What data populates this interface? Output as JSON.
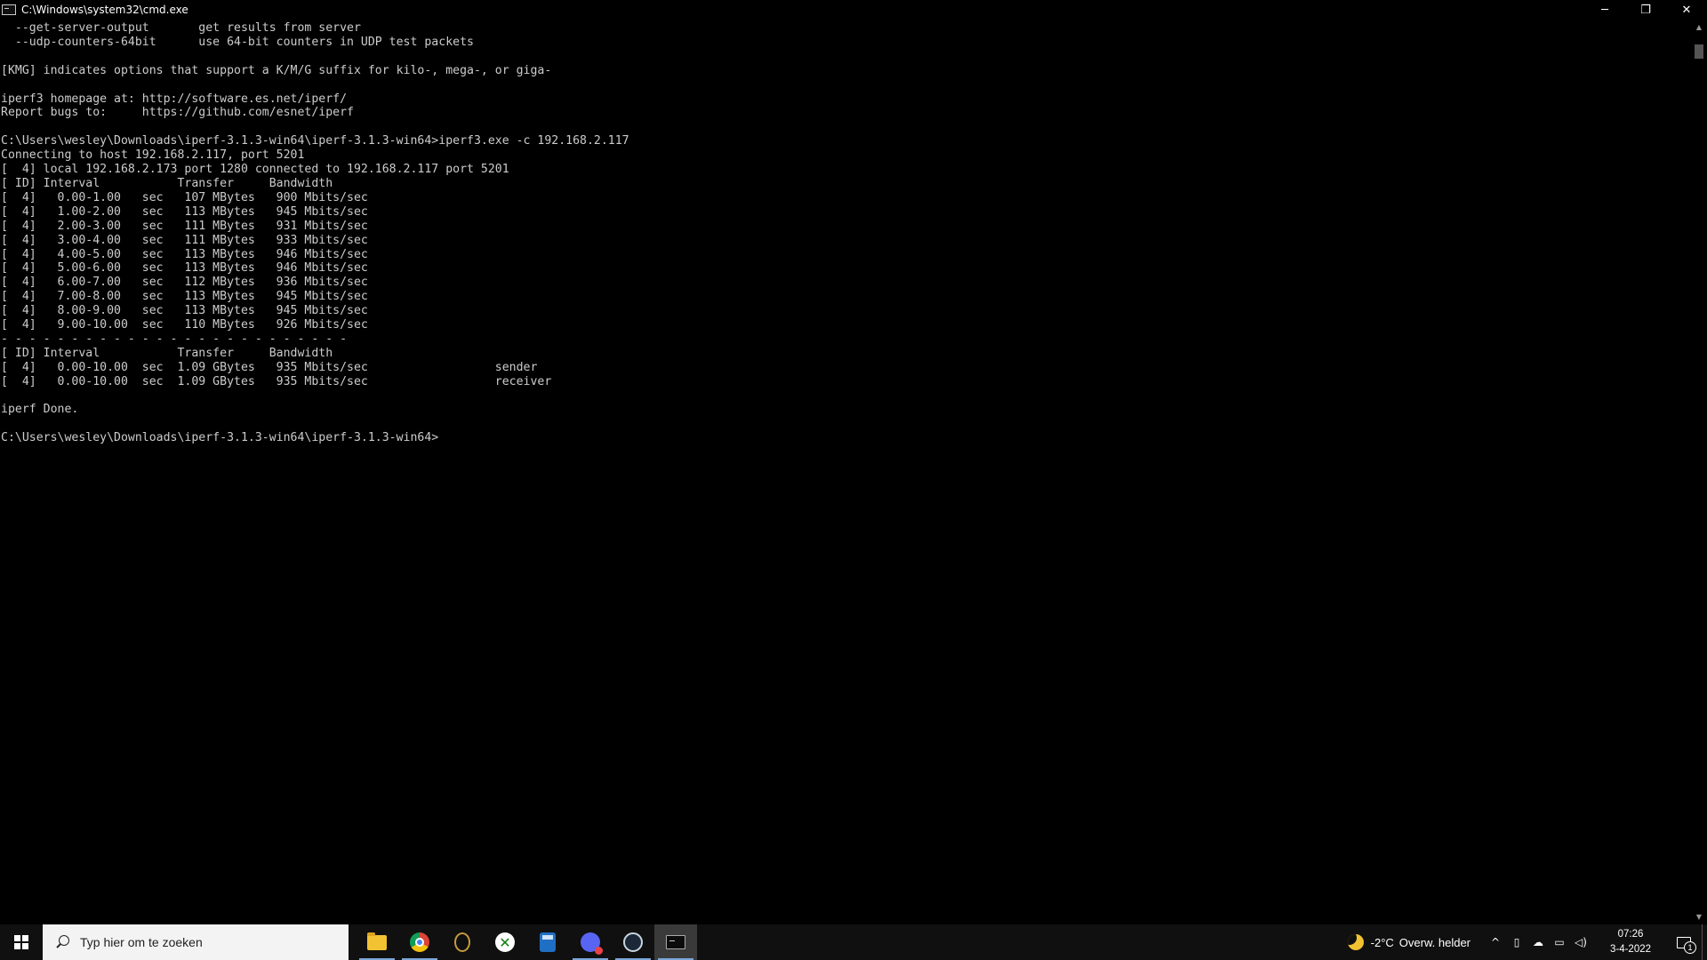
{
  "window": {
    "title": "C:\\Windows\\system32\\cmd.exe",
    "minimize_glyph": "─",
    "restore_glyph": "❐",
    "close_glyph": "✕"
  },
  "console": {
    "lines": [
      "  --get-server-output       get results from server",
      "  --udp-counters-64bit      use 64-bit counters in UDP test packets",
      "",
      "[KMG] indicates options that support a K/M/G suffix for kilo-, mega-, or giga-",
      "",
      "iperf3 homepage at: http://software.es.net/iperf/",
      "Report bugs to:     https://github.com/esnet/iperf",
      "",
      "C:\\Users\\wesley\\Downloads\\iperf-3.1.3-win64\\iperf-3.1.3-win64>iperf3.exe -c 192.168.2.117",
      "Connecting to host 192.168.2.117, port 5201",
      "[  4] local 192.168.2.173 port 1280 connected to 192.168.2.117 port 5201",
      "[ ID] Interval           Transfer     Bandwidth",
      "[  4]   0.00-1.00   sec   107 MBytes   900 Mbits/sec",
      "[  4]   1.00-2.00   sec   113 MBytes   945 Mbits/sec",
      "[  4]   2.00-3.00   sec   111 MBytes   931 Mbits/sec",
      "[  4]   3.00-4.00   sec   111 MBytes   933 Mbits/sec",
      "[  4]   4.00-5.00   sec   113 MBytes   946 Mbits/sec",
      "[  4]   5.00-6.00   sec   113 MBytes   946 Mbits/sec",
      "[  4]   6.00-7.00   sec   112 MBytes   936 Mbits/sec",
      "[  4]   7.00-8.00   sec   113 MBytes   945 Mbits/sec",
      "[  4]   8.00-9.00   sec   113 MBytes   945 Mbits/sec",
      "[  4]   9.00-10.00  sec   110 MBytes   926 Mbits/sec",
      "- - - - - - - - - - - - - - - - - - - - - - - - -",
      "[ ID] Interval           Transfer     Bandwidth",
      "[  4]   0.00-10.00  sec  1.09 GBytes   935 Mbits/sec                  sender",
      "[  4]   0.00-10.00  sec  1.09 GBytes   935 Mbits/sec                  receiver",
      "",
      "iperf Done.",
      "",
      "C:\\Users\\wesley\\Downloads\\iperf-3.1.3-win64\\iperf-3.1.3-win64>"
    ]
  },
  "scrollbar": {
    "up_glyph": "▲",
    "down_glyph": "▼"
  },
  "taskbar": {
    "search_placeholder": "Typ hier om te zoeken",
    "apps": [
      {
        "name": "file-explorer-icon",
        "cls": "folder",
        "running": true,
        "active": false
      },
      {
        "name": "chrome-icon",
        "cls": "chrome",
        "running": true,
        "active": false
      },
      {
        "name": "league-of-legends-icon",
        "cls": "lol",
        "running": false,
        "active": false
      },
      {
        "name": "xbox-icon",
        "cls": "xbox",
        "running": false,
        "active": false
      },
      {
        "name": "calculator-icon",
        "cls": "calc",
        "running": false,
        "active": false
      },
      {
        "name": "discord-icon",
        "cls": "discord",
        "running": true,
        "active": false
      },
      {
        "name": "steam-icon",
        "cls": "steam",
        "running": true,
        "active": false
      },
      {
        "name": "cmd-icon",
        "cls": "cmd",
        "running": true,
        "active": true
      }
    ],
    "weather": {
      "temp": "-2°C",
      "desc": "Overw. helder"
    },
    "tray_icons": {
      "chevron": "^",
      "device": "▯",
      "cloud": "☁",
      "network": "▭",
      "volume": "◁)"
    },
    "clock": {
      "time": "07:26",
      "date": "3-4-2022"
    },
    "notification_count": "1"
  }
}
